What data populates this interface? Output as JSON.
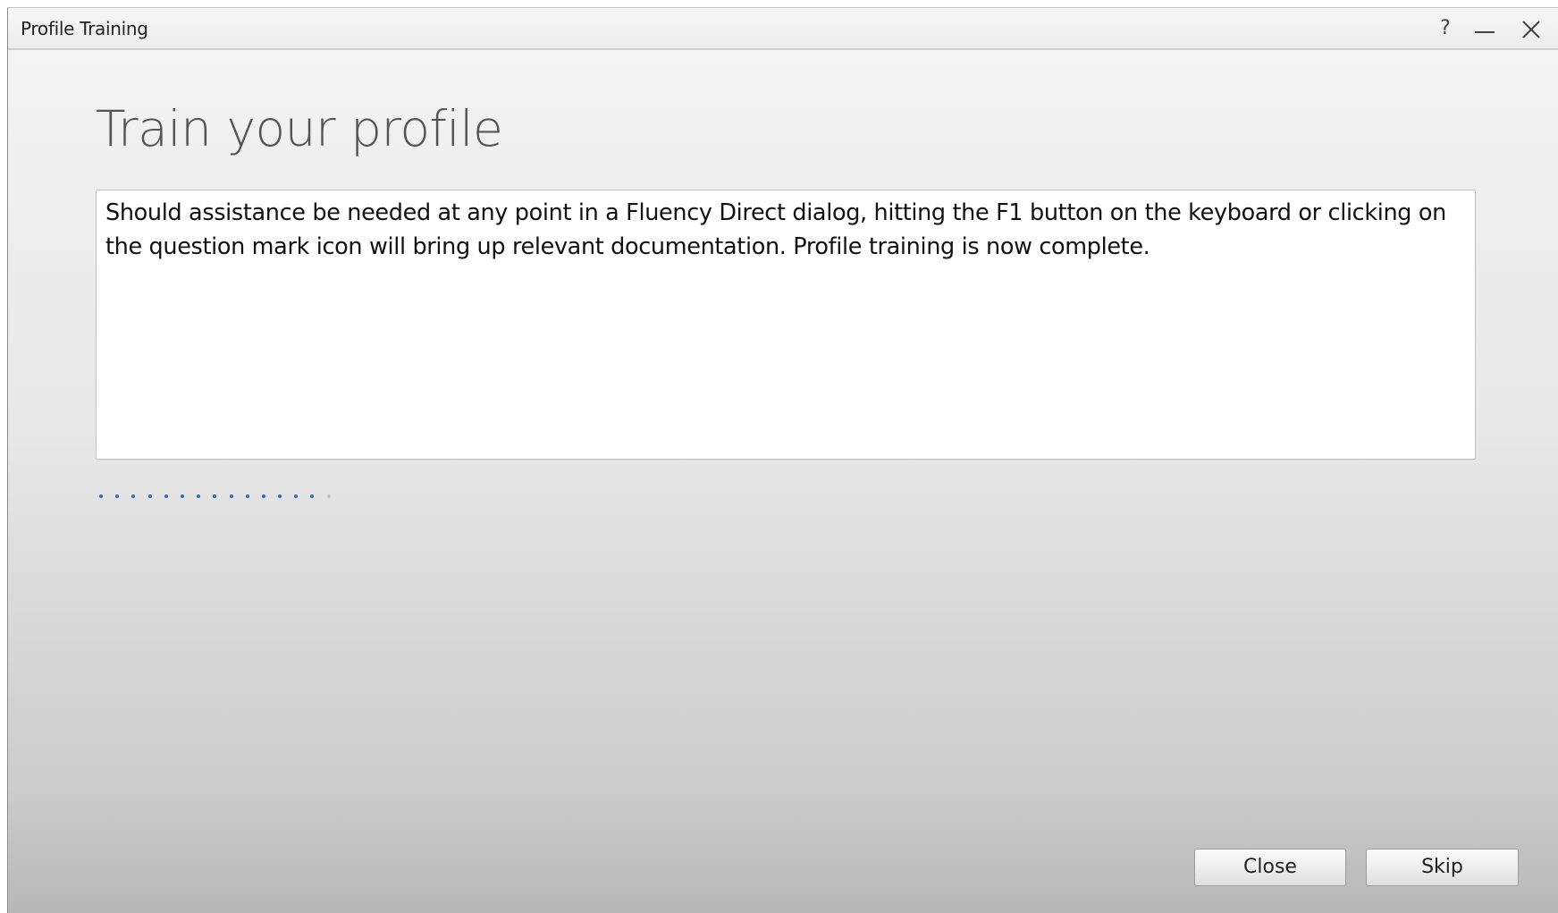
{
  "window": {
    "title": "Profile Training",
    "help_glyph": "?",
    "minimize_icon": "minimize-icon",
    "close_icon": "close-icon"
  },
  "main": {
    "heading": "Train your profile",
    "message": "Should assistance be needed at any point in a Fluency Direct dialog, hitting the F1 button on the keyboard or clicking on the question mark icon will bring up relevant documentation. Profile training is now complete.",
    "progress": {
      "total_steps": 15,
      "completed_steps": 14,
      "active_color": "#2a6ebb",
      "pending_color": "#c2c2c2"
    }
  },
  "footer": {
    "close_label": "Close",
    "skip_label": "Skip"
  }
}
